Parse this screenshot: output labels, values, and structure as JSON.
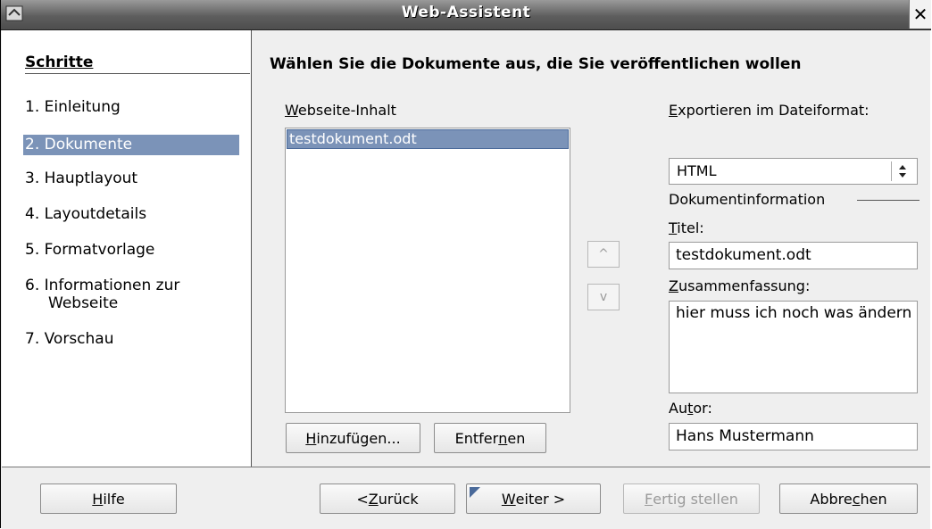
{
  "window": {
    "title": "Web-Assistent"
  },
  "sidebar": {
    "heading": "Schritte",
    "steps": [
      "1. Einleitung",
      "2. Dokumente",
      "3. Hauptlayout",
      "4. Layoutdetails",
      "5. Formatvorlage",
      "6. Informationen zur",
      "Webseite",
      "7. Vorschau"
    ],
    "selected_index": 1
  },
  "main": {
    "heading": "Wählen Sie die Dokumente aus, die Sie veröffentlichen wollen",
    "content_label": {
      "u": "W",
      "rest": "ebseite-Inhalt"
    },
    "content_items": [
      "testdokument.odt"
    ],
    "add_button": {
      "u": "H",
      "rest": "inzufügen..."
    },
    "remove_button": {
      "pre": "Entfer",
      "u": "n",
      "rest": "en"
    },
    "up_arrow": "^",
    "down_arrow": "v",
    "export_label": {
      "u": "E",
      "rest": "xportieren im Dateiformat:"
    },
    "export_format": "HTML",
    "docinfo_label": "Dokumentinformation",
    "title_label": {
      "u": "T",
      "rest": "itel:"
    },
    "title_value": "testdokument.odt",
    "summary_label": {
      "u": "Z",
      "rest": "usammenfassung:"
    },
    "summary_value": "hier muss ich noch was ändern",
    "author_label": {
      "pre": "Au",
      "u": "t",
      "rest": "or:"
    },
    "author_value": "Hans Mustermann"
  },
  "footer": {
    "help": {
      "u": "H",
      "rest": "ilfe"
    },
    "back": {
      "pre": "< ",
      "u": "Z",
      "rest": "urück"
    },
    "next": {
      "u": "W",
      "rest": "eiter >"
    },
    "finish": {
      "u": "F",
      "rest": "ertig stellen"
    },
    "cancel": {
      "pre": "Abbre",
      "u": "c",
      "rest": "hen"
    }
  },
  "colors": {
    "selection": "#7b93b8",
    "titlebar": "#5e5e5e"
  }
}
